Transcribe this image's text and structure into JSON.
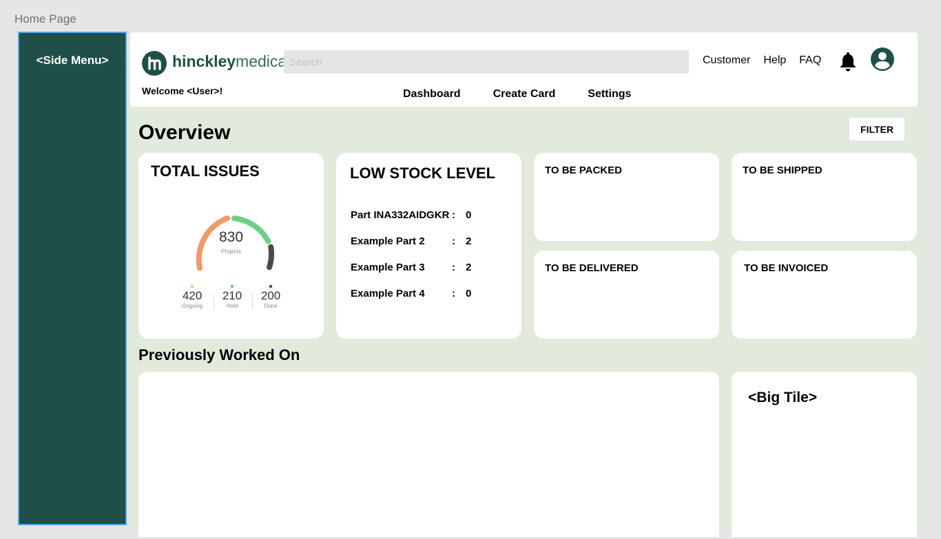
{
  "frame_title": "Home Page",
  "side_menu": {
    "label": "<Side Menu>"
  },
  "header": {
    "logo": {
      "bold": "hinckley",
      "light": "medical"
    },
    "search_placeholder": "Search",
    "links": [
      "Customer",
      "Help",
      "FAQ"
    ],
    "welcome": "Welcome <User>!",
    "nav": [
      "Dashboard",
      "Create Card",
      "Settings"
    ]
  },
  "overview": {
    "title": "Overview",
    "filter_label": "FILTER"
  },
  "total_issues": {
    "title": "TOTAL ISSUES",
    "center_value": "830",
    "center_label": "Projects",
    "stats": [
      {
        "value": "420",
        "label": "Ongoing",
        "color": "#f5c878"
      },
      {
        "value": "210",
        "label": "Hold",
        "color": "#6fcf87"
      },
      {
        "value": "200",
        "label": "Done",
        "color": "#555555"
      }
    ],
    "gauge_colors": {
      "ongoing": "#f0996a",
      "hold": "#6fcf87",
      "done": "#4a4a4a"
    }
  },
  "low_stock": {
    "title": "LOW STOCK LEVEL",
    "items": [
      {
        "name": "Part INA332AIDGKR",
        "sep": ":",
        "qty": "0"
      },
      {
        "name": "Example Part 2",
        "sep": ":",
        "qty": "2"
      },
      {
        "name": "Example Part 3",
        "sep": ":",
        "qty": "2"
      },
      {
        "name": "Example Part 4",
        "sep": ":",
        "qty": "0"
      }
    ]
  },
  "status_cards": {
    "packed": "TO BE PACKED",
    "shipped": "TO BE SHIPPED",
    "delivered": "TO BE DELIVERED",
    "invoiced": "TO BE INVOICED"
  },
  "previously_worked_on": {
    "title": "Previously Worked On"
  },
  "big_tile": {
    "title": "<Big Tile>"
  },
  "colors": {
    "brand": "#1f4f48",
    "page_bg": "#e2e9dd",
    "selection": "#4ea6e8"
  }
}
